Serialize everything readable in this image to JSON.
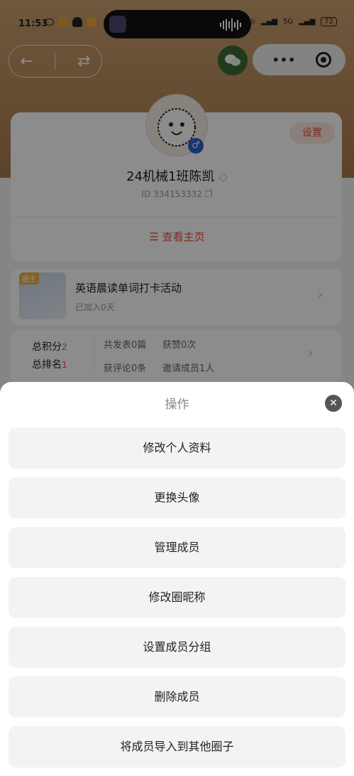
{
  "status": {
    "time": "11:53",
    "battery": "72",
    "network_label": "5G"
  },
  "nav": {
    "back_icon": "back-arrow-icon",
    "switch_icon": "switch-arrows-icon",
    "capsule_dots": "•••"
  },
  "profile": {
    "settings_label": "设置",
    "name": "24机械1班陈凯",
    "id_text": "ID 334153332",
    "view_home_label": "查看主页",
    "gender_symbol": "♂"
  },
  "circle": {
    "owner_tag": "圈主",
    "title": "英语晨读单词打卡活动",
    "joined": "已加入0天"
  },
  "stats": {
    "total_points_label": "总积分",
    "total_points_value": "2",
    "total_rank_label": "总排名",
    "total_rank_value": "1",
    "posts": "共发表0篇",
    "likes": "获赞0次",
    "comments": "获评论0条",
    "invites": "邀请成员1人"
  },
  "sheet": {
    "title": "操作",
    "close_symbol": "✕",
    "actions": [
      "修改个人资料",
      "更换头像",
      "管理成员",
      "修改圈昵称",
      "设置成员分组",
      "删除成员",
      "将成员导入到其他圈子"
    ]
  },
  "colors": {
    "accent": "#e2523a",
    "sheet_bg": "#ffffff",
    "action_bg": "#f3f3f3"
  }
}
